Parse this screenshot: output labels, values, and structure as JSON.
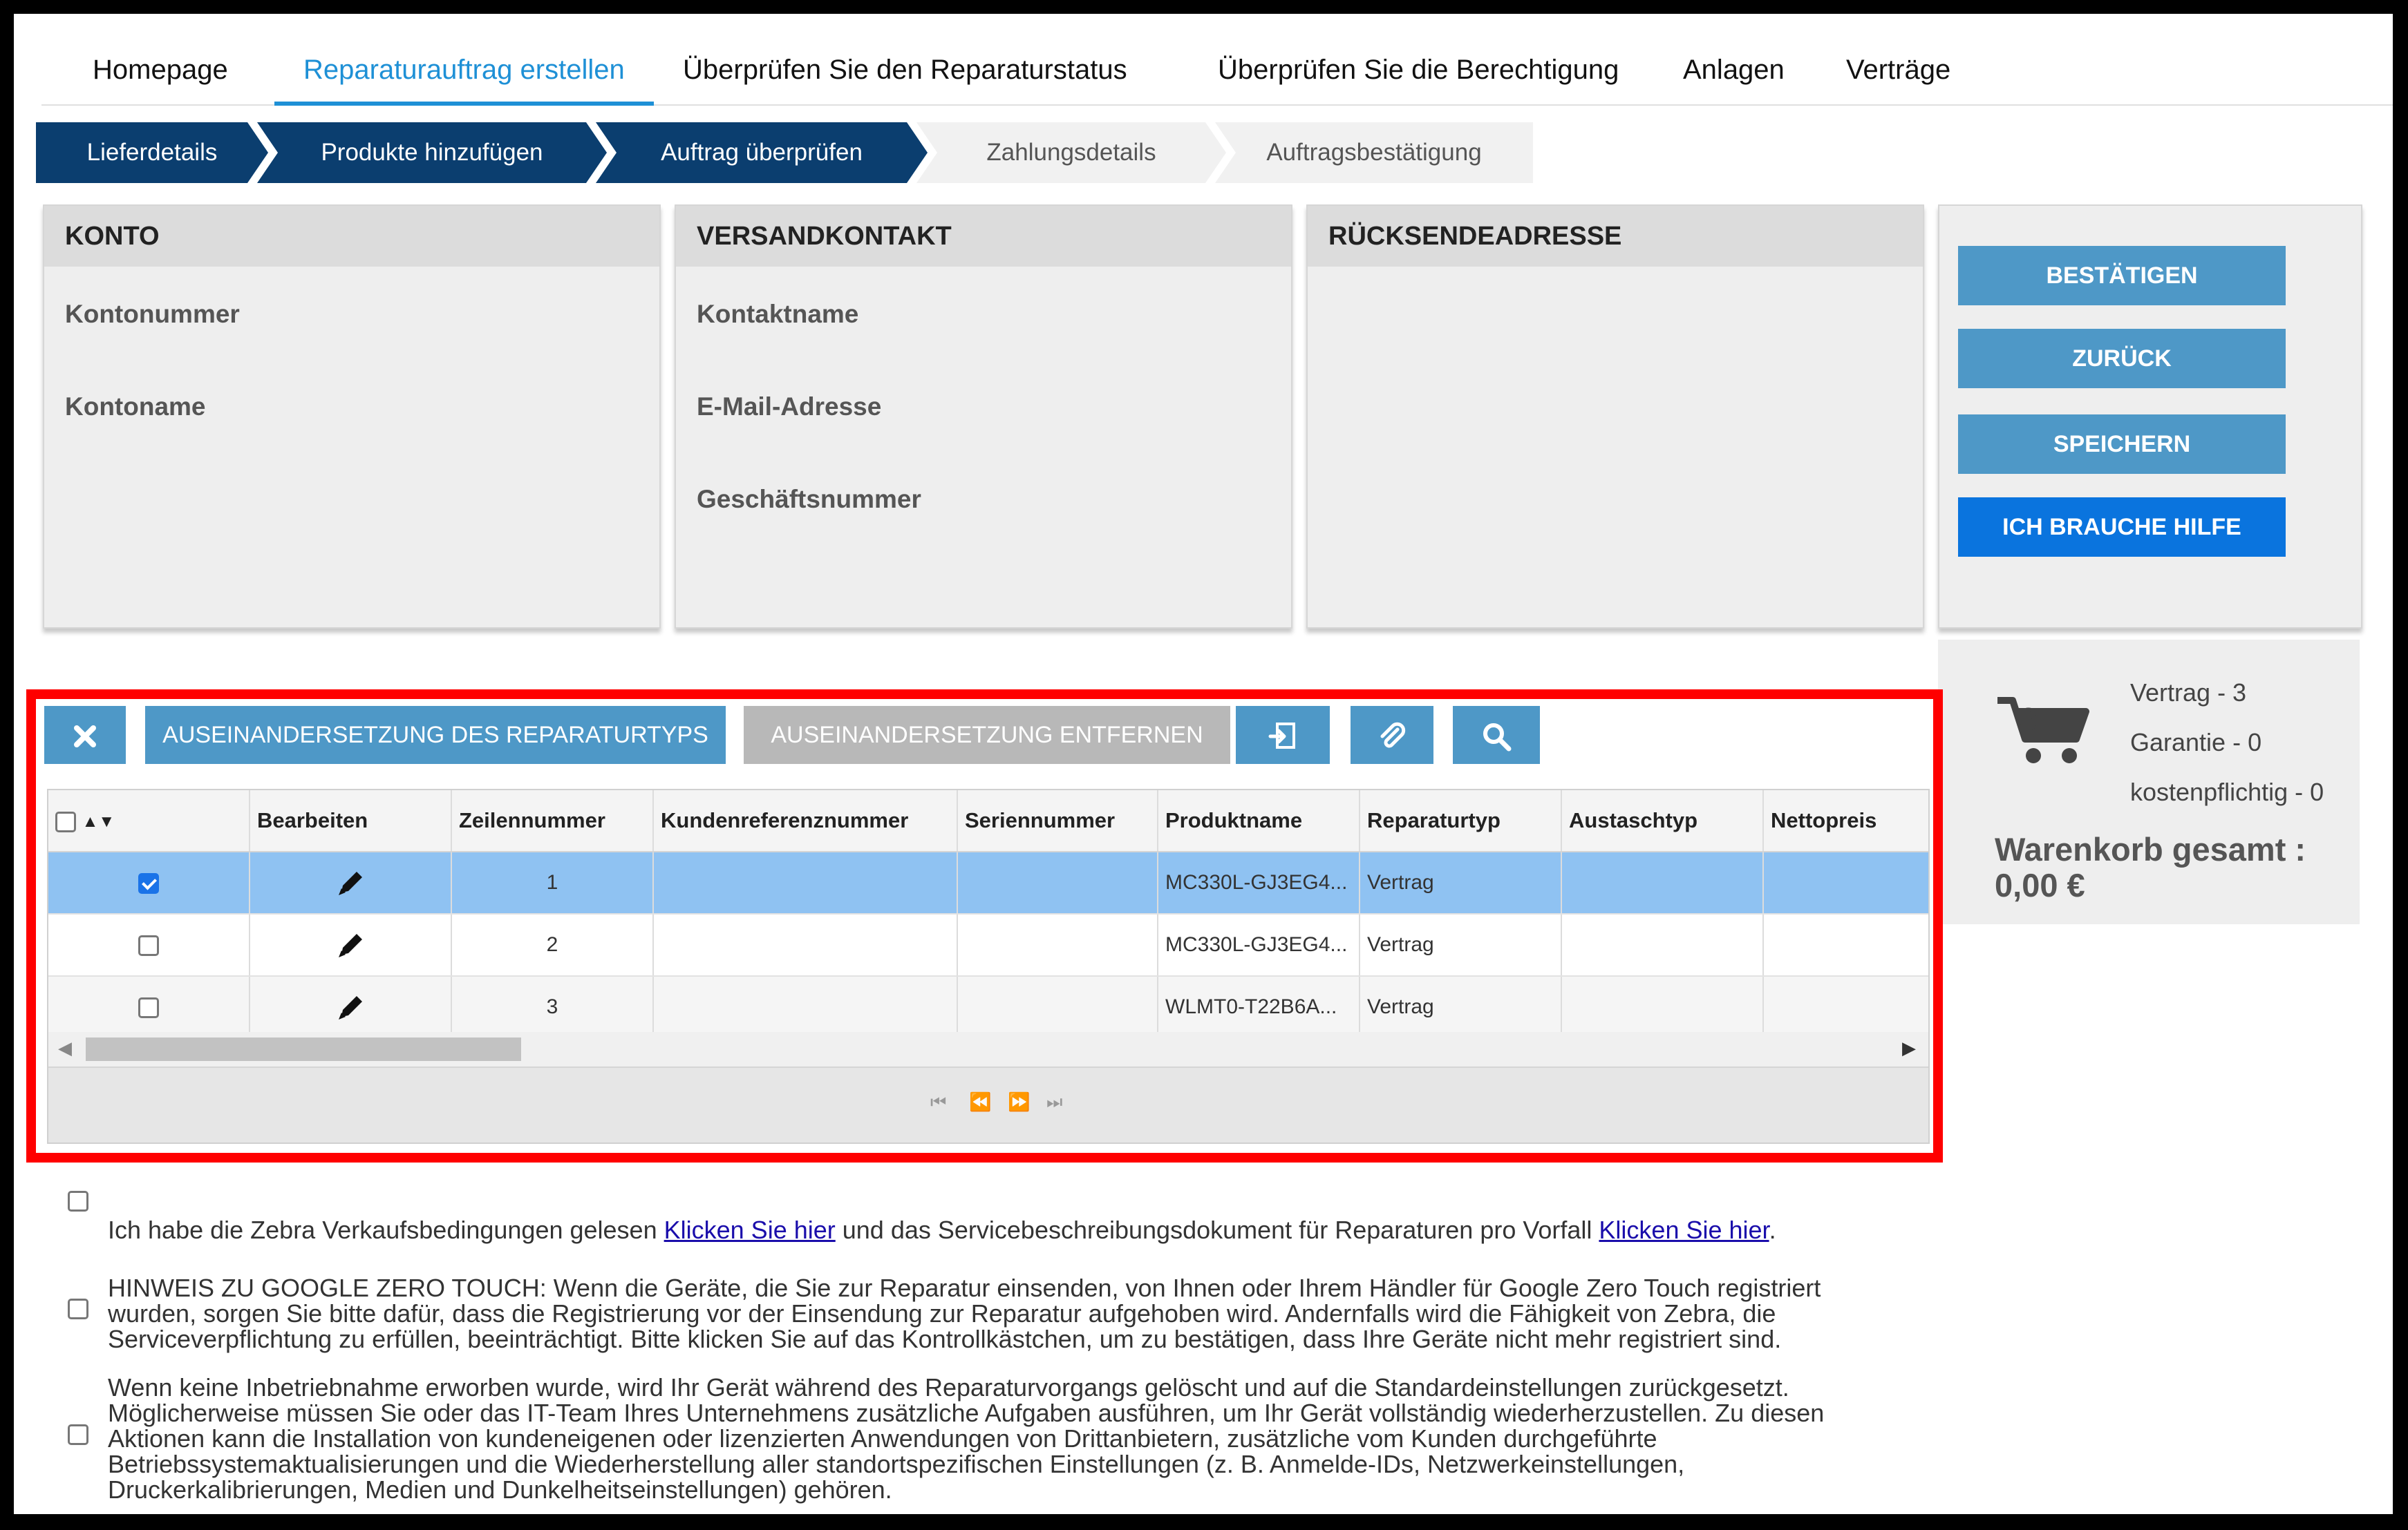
{
  "nav": {
    "items": [
      {
        "label": "Homepage"
      },
      {
        "label": "Reparaturauftrag erstellen"
      },
      {
        "label": "Überprüfen Sie den Reparaturstatus"
      },
      {
        "label": "Überprüfen Sie die Berechtigung"
      },
      {
        "label": "Anlagen"
      },
      {
        "label": "Verträge"
      }
    ],
    "active_index": 1
  },
  "steps": [
    {
      "label": "Lieferdetails",
      "state": "done"
    },
    {
      "label": "Produkte hinzufügen",
      "state": "done"
    },
    {
      "label": "Auftrag überprüfen",
      "state": "done"
    },
    {
      "label": "Zahlungsdetails",
      "state": "todo"
    },
    {
      "label": "Auftragsbestätigung",
      "state": "todo"
    }
  ],
  "panels": {
    "konto": {
      "title": "KONTO",
      "fields": [
        "Kontonummer",
        "Kontoname"
      ]
    },
    "versandkontakt": {
      "title": "VERSANDKONTAKT",
      "fields": [
        "Kontaktname",
        "E-Mail-Adresse",
        "Geschäftsnummer"
      ]
    },
    "ruecksendeadresse": {
      "title": "RÜCKSENDEADRESSE"
    }
  },
  "actions": {
    "confirm": "BESTÄTIGEN",
    "back": "ZURÜCK",
    "save": "SPEICHERN",
    "help": "ICH BRAUCHE HILFE"
  },
  "cart": {
    "count": "3",
    "contract": "Vertrag - 3",
    "warranty": "Garantie - 0",
    "chargeable": "kostenpflichtig - 0",
    "total_label": "Warenkorb gesamt :",
    "total_value": "0,00 €"
  },
  "toolbar": {
    "dispute_type": "AUSEINANDERSETZUNG DES REPARATURTYPS",
    "remove_dispute": "AUSEINANDERSETZUNG ENTFERNEN"
  },
  "grid": {
    "columns": [
      "Bearbeiten",
      "Zeilennummer",
      "Kundenreferenznummer",
      "Seriennummer",
      "Produktname",
      "Reparaturtyp",
      "Austaschtyp",
      "Nettopreis"
    ],
    "rows": [
      {
        "checked": true,
        "line": "1",
        "customer_ref": "",
        "serial": "",
        "product": "MC330L-GJ3EG4...",
        "repair_type": "Vertrag",
        "exchange_type": "",
        "net_price": ""
      },
      {
        "checked": false,
        "line": "2",
        "customer_ref": "",
        "serial": "",
        "product": "MC330L-GJ3EG4...",
        "repair_type": "Vertrag",
        "exchange_type": "",
        "net_price": ""
      },
      {
        "checked": false,
        "line": "3",
        "customer_ref": "",
        "serial": "",
        "product": "WLMT0-T22B6A...",
        "repair_type": "Vertrag",
        "exchange_type": "",
        "net_price": ""
      }
    ]
  },
  "agreements": {
    "terms_part1": "Ich habe die Zebra Verkaufsbedingungen gelesen",
    "terms_link1": "Klicken Sie hier",
    "terms_part2": "und das Servicebeschreibungsdokument für Reparaturen pro Vorfall",
    "terms_link2": "Klicken Sie hier",
    "terms_end": ".",
    "zero_touch_lines": [
      "HINWEIS ZU GOOGLE ZERO TOUCH: Wenn die Geräte, die Sie zur Reparatur einsenden, von Ihnen oder Ihrem Händler für Google Zero Touch registriert",
      "wurden, sorgen Sie bitte dafür, dass die Registrierung vor der Einsendung zur Reparatur aufgehoben wird. Andernfalls wird die Fähigkeit von Zebra, die",
      "Serviceverpflichtung zu erfüllen, beeinträchtigt. Bitte klicken Sie auf das Kontrollkästchen, um zu bestätigen, dass Ihre Geräte nicht mehr registriert sind."
    ],
    "commissioning_lines": [
      "Wenn keine Inbetriebnahme erworben wurde, wird Ihr Gerät während des Reparaturvorgangs gelöscht und auf die Standardeinstellungen zurückgesetzt.",
      "Möglicherweise müssen Sie oder das IT-Team Ihres Unternehmens zusätzliche Aufgaben ausführen, um Ihr Gerät vollständig wiederherzustellen. Zu diesen",
      "Aktionen kann die Installation von kundeneigenen oder lizenzierten Anwendungen von Drittanbietern, zusätzliche vom Kunden durchgeführte",
      "Betriebssystemaktualisierungen und die Wiederherstellung aller standortspezifischen Einstellungen (z. B. Anmelde-IDs, Netzwerkeinstellungen,",
      "Druckerkalibrierungen, Medien und Dunkelheitseinstellungen) gehören."
    ]
  },
  "colors": {
    "accent": "#1e90d6",
    "step_done": "#0b3e6f",
    "button_blue": "#4e98c7",
    "help_button": "#0a74de",
    "highlight_red": "#ff0000",
    "selected_row": "#8fc2f2"
  }
}
